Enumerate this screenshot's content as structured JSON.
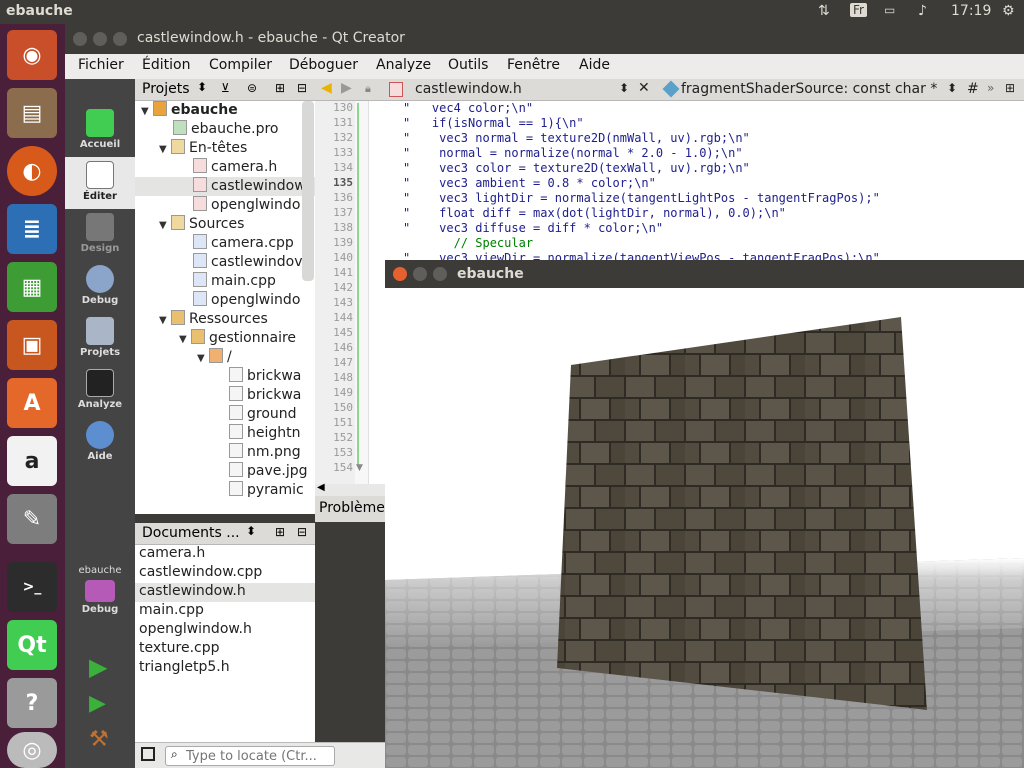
{
  "top_panel": {
    "app_name": "ebauche",
    "keyboard_layout": "Fr",
    "clock": "17:19"
  },
  "launcher": {
    "items": [
      "ubuntu-dash-icon",
      "files-icon",
      "firefox-icon",
      "writer-icon",
      "calc-icon",
      "impress-icon",
      "software-center-icon",
      "amazon-icon",
      "system-settings-icon",
      "terminal-icon",
      "qt-creator-icon",
      "help-icon",
      "dvd-icon"
    ]
  },
  "qt_window": {
    "title": "castlewindow.h - ebauche - Qt Creator",
    "menu": [
      "Fichier",
      "Édition",
      "Compiler",
      "Déboguer",
      "Analyze",
      "Outils",
      "Fenêtre",
      "Aide"
    ]
  },
  "modes": [
    {
      "label": "Accueil"
    },
    {
      "label": "Éditer"
    },
    {
      "label": "Design"
    },
    {
      "label": "Debug"
    },
    {
      "label": "Projets"
    },
    {
      "label": "Analyze"
    },
    {
      "label": "Aide"
    }
  ],
  "kit": {
    "project": "ebauche",
    "mode": "Debug"
  },
  "project_pane": {
    "title": "Projets",
    "tree": [
      {
        "label": "ebauche"
      },
      {
        "label": "ebauche.pro"
      },
      {
        "label": "En-têtes"
      },
      {
        "label": "camera.h"
      },
      {
        "label": "castlewindow"
      },
      {
        "label": "openglwindo"
      },
      {
        "label": "Sources"
      },
      {
        "label": "camera.cpp"
      },
      {
        "label": "castlewindov"
      },
      {
        "label": "main.cpp"
      },
      {
        "label": "openglwindo"
      },
      {
        "label": "Ressources"
      },
      {
        "label": "gestionnaire"
      },
      {
        "label": "/"
      },
      {
        "label": "brickwa"
      },
      {
        "label": "brickwa"
      },
      {
        "label": "ground"
      },
      {
        "label": "heightn"
      },
      {
        "label": "nm.png"
      },
      {
        "label": "pave.jpg"
      },
      {
        "label": "pyramic"
      }
    ]
  },
  "documents_pane": {
    "title": "Documents ...",
    "items": [
      "camera.h",
      "castlewindow.cpp",
      "castlewindow.h",
      "main.cpp",
      "openglwindow.h",
      "texture.cpp",
      "triangletp5.h"
    ]
  },
  "locator": {
    "placeholder": "Type to locate (Ctr..."
  },
  "problems": {
    "label": "Problème"
  },
  "editor": {
    "file_tab": "castlewindow.h",
    "symbol": "fragmentShaderSource: const char *",
    "hash": "#",
    "line_numbers": [
      "130",
      "131",
      "132",
      "133",
      "134",
      "135",
      "136",
      "137",
      "138",
      "139",
      "140",
      "141",
      "142",
      "143",
      "144",
      "145",
      "146",
      "147",
      "148",
      "149",
      "150",
      "151",
      "152",
      "153",
      "154"
    ],
    "current_line": "135",
    "code": [
      "\"   vec4 color;\\n\"",
      "\"   if(isNormal == 1){\\n\"",
      "\"    vec3 normal = texture2D(nmWall, uv).rgb;\\n\"",
      "\"    normal = normalize(normal * 2.0 - 1.0);\\n\"",
      "\"    vec3 color = texture2D(texWall, uv).rgb;\\n\"",
      "\"    vec3 ambient = 0.8 * color;\\n\"",
      "\"    vec3 lightDir = normalize(tangentLightPos - tangentFragPos);\"",
      "\"    float diff = max(dot(lightDir, normal), 0.0);\\n\"",
      "\"    vec3 diffuse = diff * color;\\n\"",
      "       // Specular",
      "\"    vec3 viewDir = normalize(tangentViewPos - tangentFragPos);\\n\""
    ]
  },
  "gl_window": {
    "title": "ebauche"
  }
}
